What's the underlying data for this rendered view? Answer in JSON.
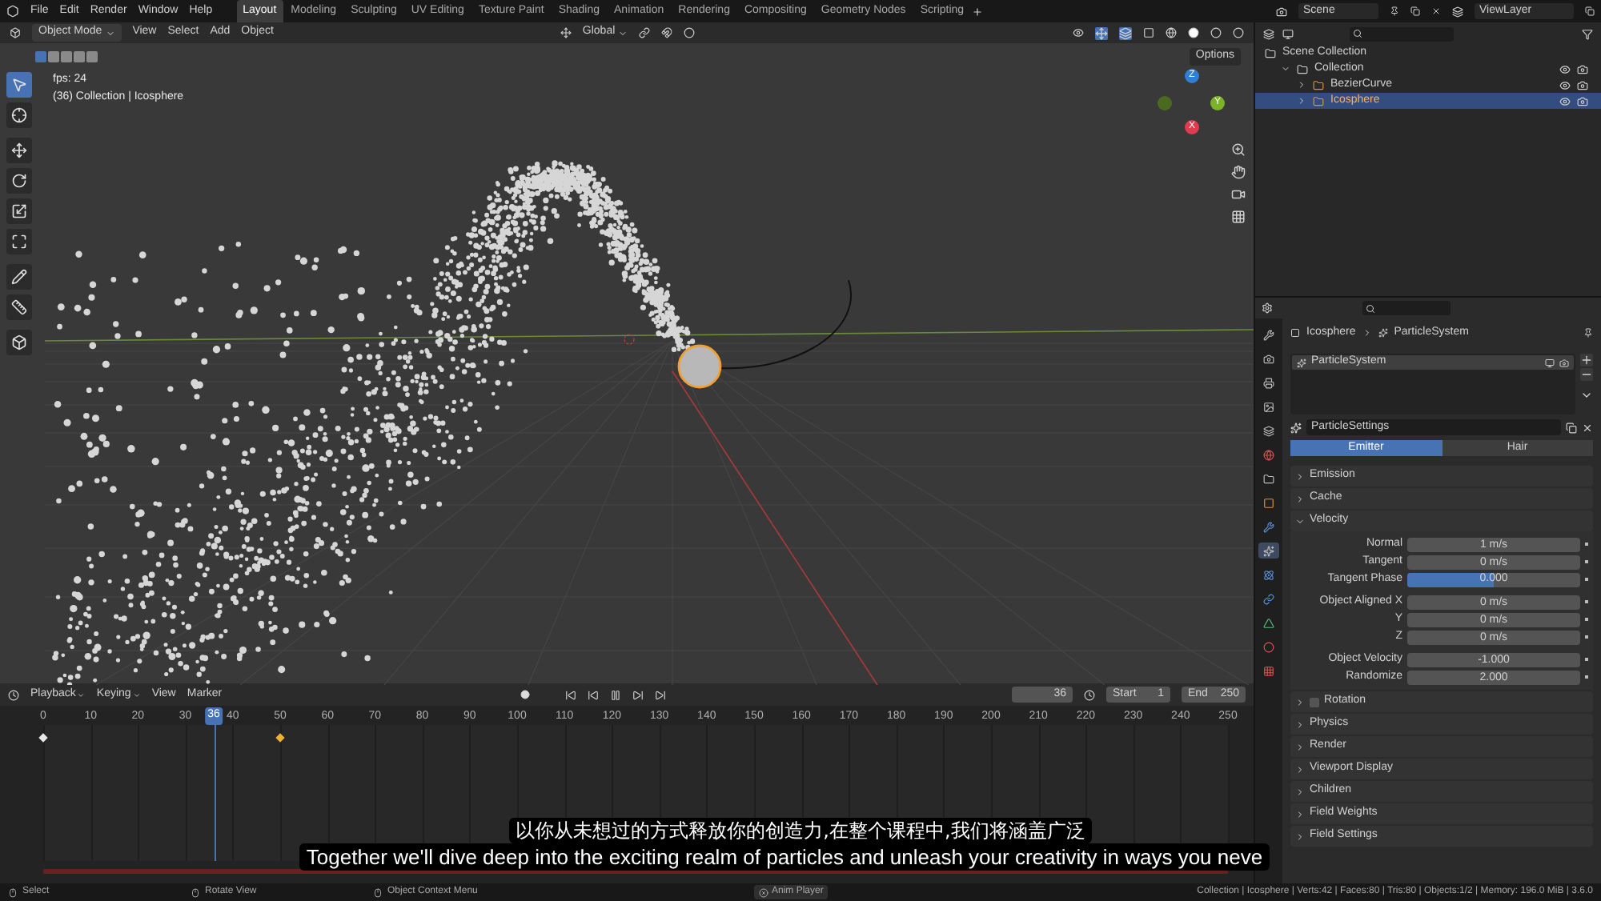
{
  "menu": [
    "File",
    "Edit",
    "Render",
    "Window",
    "Help"
  ],
  "workspaces": [
    {
      "label": "Layout",
      "selected": true
    },
    {
      "label": "Modeling",
      "selected": false
    },
    {
      "label": "Sculpting",
      "selected": false
    },
    {
      "label": "UV Editing",
      "selected": false
    },
    {
      "label": "Texture Paint",
      "selected": false
    },
    {
      "label": "Shading",
      "selected": false
    },
    {
      "label": "Animation",
      "selected": false
    },
    {
      "label": "Rendering",
      "selected": false
    },
    {
      "label": "Compositing",
      "selected": false
    },
    {
      "label": "Geometry Nodes",
      "selected": false
    },
    {
      "label": "Scripting",
      "selected": false
    }
  ],
  "scene": {
    "name": "Scene",
    "view_layer": "ViewLayer"
  },
  "viewport_header": {
    "mode": "Object Mode",
    "menus": [
      "View",
      "Select",
      "Add",
      "Object"
    ],
    "orientation": "Global"
  },
  "viewport": {
    "select_modes": [
      {
        "selected": true
      },
      {
        "selected": false
      },
      {
        "selected": false
      },
      {
        "selected": false
      },
      {
        "selected": false
      }
    ],
    "tools": [
      {
        "selected": true
      },
      {
        "selected": false
      },
      {
        "selected": false
      },
      {
        "selected": false
      },
      {
        "selected": false
      },
      {
        "selected": false
      },
      {
        "selected": false
      },
      {
        "selected": false
      },
      {
        "selected": false
      }
    ],
    "info_lines": [
      "fps: 24",
      "(36) Collection | Icosphere"
    ],
    "options": "Options",
    "gizmo": [
      "Z",
      "Y",
      "X"
    ]
  },
  "outliner": {
    "tree": [
      {
        "label": "Scene Collection",
        "selected": false,
        "children": [
          {
            "label": "Collection",
            "selected": false,
            "children": [
              {
                "label": "BezierCurve",
                "selected": false
              },
              {
                "label": "Icosphere",
                "selected": true
              }
            ]
          }
        ]
      }
    ]
  },
  "properties": {
    "tabs": [
      {
        "selected": false
      },
      {
        "selected": false
      },
      {
        "selected": false
      },
      {
        "selected": false
      },
      {
        "selected": false
      },
      {
        "selected": false
      },
      {
        "selected": false
      },
      {
        "selected": false
      },
      {
        "selected": false
      },
      {
        "selected": true
      },
      {
        "selected": false
      },
      {
        "selected": false
      },
      {
        "selected": false
      },
      {
        "selected": false
      },
      {
        "selected": false
      }
    ],
    "breadcrumb": [
      "Icosphere",
      "ParticleSystem"
    ],
    "systems": [
      {
        "label": "ParticleSystem",
        "selected": true
      }
    ],
    "settings_name": "ParticleSettings",
    "types": [
      {
        "label": "Emitter",
        "selected": true
      },
      {
        "label": "Hair",
        "selected": false
      }
    ],
    "panels": [
      {
        "label": "Emission",
        "expanded": false
      },
      {
        "label": "Cache",
        "expanded": false
      },
      {
        "label": "Velocity",
        "expanded": true,
        "groups": [
          [
            {
              "label": "Normal",
              "value": "1 m/s",
              "kind": "number"
            },
            {
              "label": "Tangent",
              "value": "0 m/s",
              "kind": "number"
            },
            {
              "label": "Tangent Phase",
              "value": "0.000",
              "kind": "slider",
              "level": 0.5
            }
          ],
          [
            {
              "label": "Object Aligned X",
              "value": "0 m/s",
              "kind": "number"
            },
            {
              "label": "Y",
              "value": "0 m/s",
              "kind": "number"
            },
            {
              "label": "Z",
              "value": "0 m/s",
              "kind": "number"
            }
          ],
          [
            {
              "label": "Object Velocity",
              "value": "-1.000",
              "kind": "number"
            },
            {
              "label": "Randomize",
              "value": "2.000",
              "kind": "number"
            }
          ]
        ]
      },
      {
        "label": "Rotation",
        "expanded": false,
        "checkbox": {
          "checked": false
        }
      },
      {
        "label": "Physics",
        "expanded": false
      },
      {
        "label": "Render",
        "expanded": false
      },
      {
        "label": "Viewport Display",
        "expanded": false
      },
      {
        "label": "Children",
        "expanded": false
      },
      {
        "label": "Field Weights",
        "expanded": false
      },
      {
        "label": "Field Settings",
        "expanded": false
      }
    ]
  },
  "timeline": {
    "menus": [
      {
        "label": "Playback",
        "dropdown": true
      },
      {
        "label": "Keying",
        "dropdown": true
      },
      {
        "label": "View",
        "dropdown": false
      },
      {
        "label": "Marker",
        "dropdown": false
      }
    ],
    "current_frame": "36",
    "playhead_label": "36",
    "start_label": "Start",
    "start": "1",
    "end_label": "End",
    "end": "250",
    "ruler": [
      "0",
      "10",
      "20",
      "30",
      "40",
      "50",
      "60",
      "70",
      "80",
      "90",
      "100",
      "110",
      "120",
      "130",
      "140",
      "150",
      "160",
      "170",
      "180",
      "190",
      "200",
      "210",
      "220",
      "230",
      "240",
      "250"
    ],
    "keyframes": [
      {
        "selected": false
      },
      {
        "selected": true
      }
    ]
  },
  "status_bar": {
    "hints": [
      "Select",
      "Rotate View",
      "Object Context Menu"
    ],
    "player": "Anim Player",
    "stats": "Collection | Icosphere | Verts:42 | Faces:80 | Tris:80 | Objects:1/2 | Memory: 196.0 MiB | 3.6.0"
  },
  "subtitles": [
    "以你从未想过的方式释放你的创造力,在整个课程中,我们将涵盖广泛",
    "Together we'll dive deep into the exciting realm of particles and unleash your creativity in ways you neve"
  ]
}
